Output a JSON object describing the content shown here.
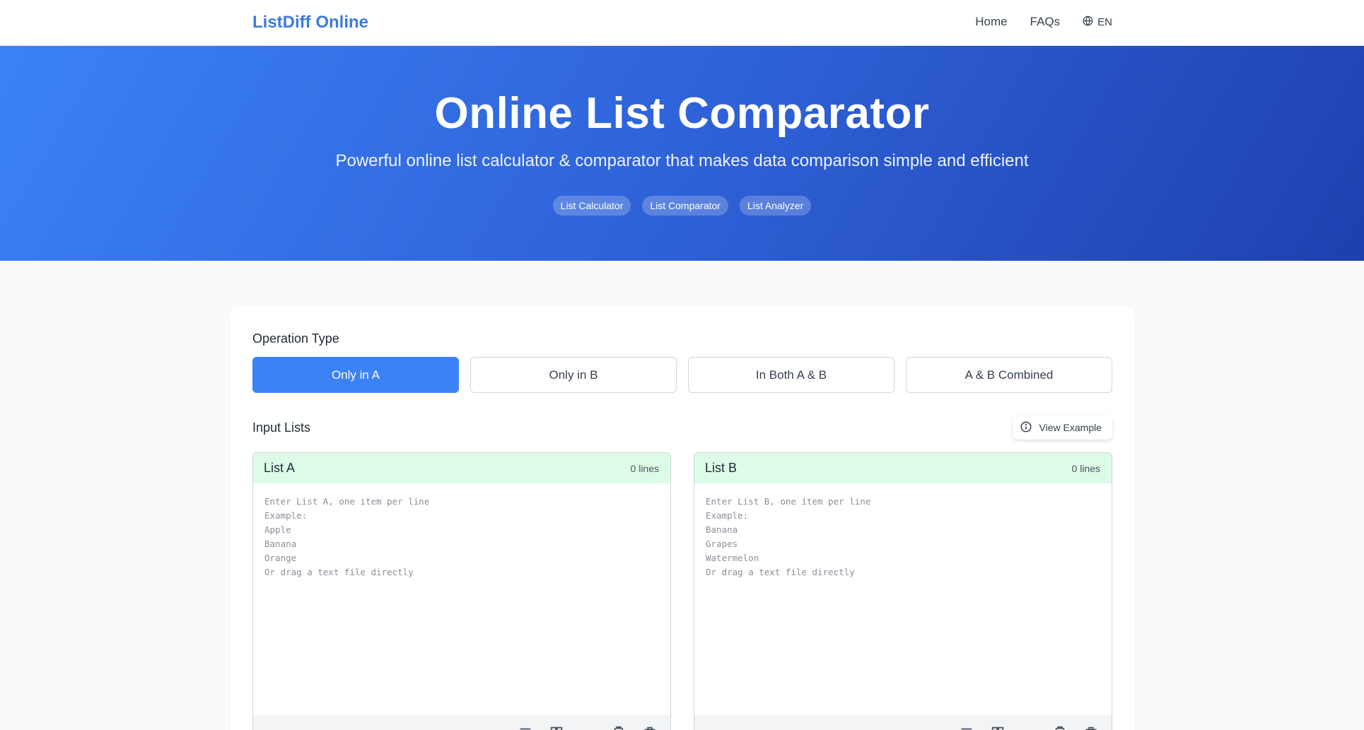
{
  "header": {
    "brand": "ListDiff Online",
    "nav": {
      "home": "Home",
      "faqs": "FAQs",
      "language": "EN"
    }
  },
  "hero": {
    "title": "Online List Comparator",
    "subtitle": "Powerful online list calculator & comparator that makes data comparison simple and efficient",
    "tags": [
      "List Calculator",
      "List Comparator",
      "List Analyzer"
    ]
  },
  "operation": {
    "label": "Operation Type",
    "options": [
      "Only in A",
      "Only in B",
      "In Both A & B",
      "A & B Combined"
    ],
    "selected": "Only in A"
  },
  "inputs": {
    "label": "Input Lists",
    "view_example": "View Example",
    "list_a": {
      "title": "List A",
      "count": "0 lines",
      "value": "",
      "placeholder": "Enter List A, one item per line\nExample:\nApple\nBanana\nOrange\nOr drag a text file directly"
    },
    "list_b": {
      "title": "List B",
      "count": "0 lines",
      "value": "",
      "placeholder": "Enter List B, one item per line\nExample:\nBanana\nGrapes\nWatermelon\nOr drag a text file directly"
    }
  },
  "tools": [
    "sort-icon",
    "dedupe-icon",
    "trim-icon",
    "copy-icon",
    "clear-icon"
  ],
  "colors": {
    "accent": "#3b82f6",
    "brand": "#3b7be0",
    "panel_header": "#dcfce7",
    "hero_start": "#3b82f6",
    "hero_end": "#1e40af"
  }
}
